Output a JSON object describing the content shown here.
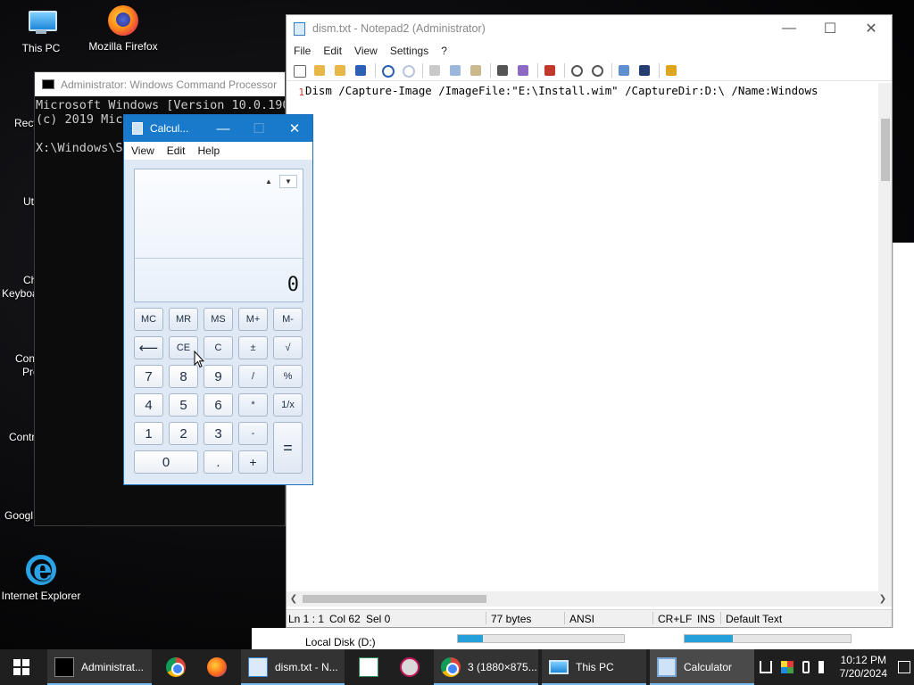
{
  "desktop": {
    "icons": [
      {
        "label": "This PC"
      },
      {
        "label": "Mozilla Firefox"
      },
      {
        "label": "Internet Explorer"
      }
    ],
    "partial_labels": [
      "Recy",
      "Ut",
      "Ch",
      "Keyboa",
      "Con",
      "Pro",
      "Contr",
      "Googl"
    ]
  },
  "cmd": {
    "title": "Administrator: Windows Command Processor",
    "lines": [
      "Microsoft Windows [Version 10.0.190",
      "(c) 2019 Mic",
      "",
      "X:\\Windows\\S"
    ]
  },
  "notepad": {
    "title": "dism.txt - Notepad2 (Administrator)",
    "menu": [
      "File",
      "Edit",
      "View",
      "Settings",
      "?"
    ],
    "line_number": "1",
    "content": "Dism /Capture-Image /ImageFile:\"E:\\Install.wim\" /CaptureDir:D:\\ /Name:Windows",
    "status": {
      "position": "Ln 1 : 1",
      "col": "Col 62",
      "sel": "Sel 0",
      "size": "77 bytes",
      "encoding": "ANSI",
      "eol": "CR+LF",
      "mode": "INS",
      "scheme": "Default Text"
    }
  },
  "explorer": {
    "drive_label": "Local Disk (D:)",
    "drive_fill_1": 0.15,
    "drive_fill_2": 0.29
  },
  "calculator": {
    "title": "Calcul...",
    "menu": [
      "View",
      "Edit",
      "Help"
    ],
    "display_value": "0",
    "history_up": "▲",
    "history_down": "▼",
    "buttons": {
      "mc": "MC",
      "mr": "MR",
      "ms": "MS",
      "mplus": "M+",
      "mminus": "M-",
      "back": "⟵",
      "ce": "CE",
      "c": "C",
      "plusminus": "±",
      "sqrt": "√",
      "n7": "7",
      "n8": "8",
      "n9": "9",
      "div": "/",
      "pct": "%",
      "n4": "4",
      "n5": "5",
      "n6": "6",
      "mul": "*",
      "recip": "1/x",
      "n1": "1",
      "n2": "2",
      "n3": "3",
      "sub": "-",
      "eq": "=",
      "n0": "0",
      "dot": ".",
      "add": "+"
    }
  },
  "taskbar": {
    "items": [
      {
        "label": "Administrat..."
      },
      {
        "label": "dism.txt - N..."
      },
      {
        "label": "3 (1880×875..."
      },
      {
        "label": "This PC"
      },
      {
        "label": "Calculator"
      }
    ],
    "clock": {
      "time": "10:12 PM",
      "date": "7/20/2024"
    }
  },
  "colors": {
    "accent": "#1979ca",
    "taskbar": "#1f1f1f",
    "line_number": "#d03a2e"
  }
}
